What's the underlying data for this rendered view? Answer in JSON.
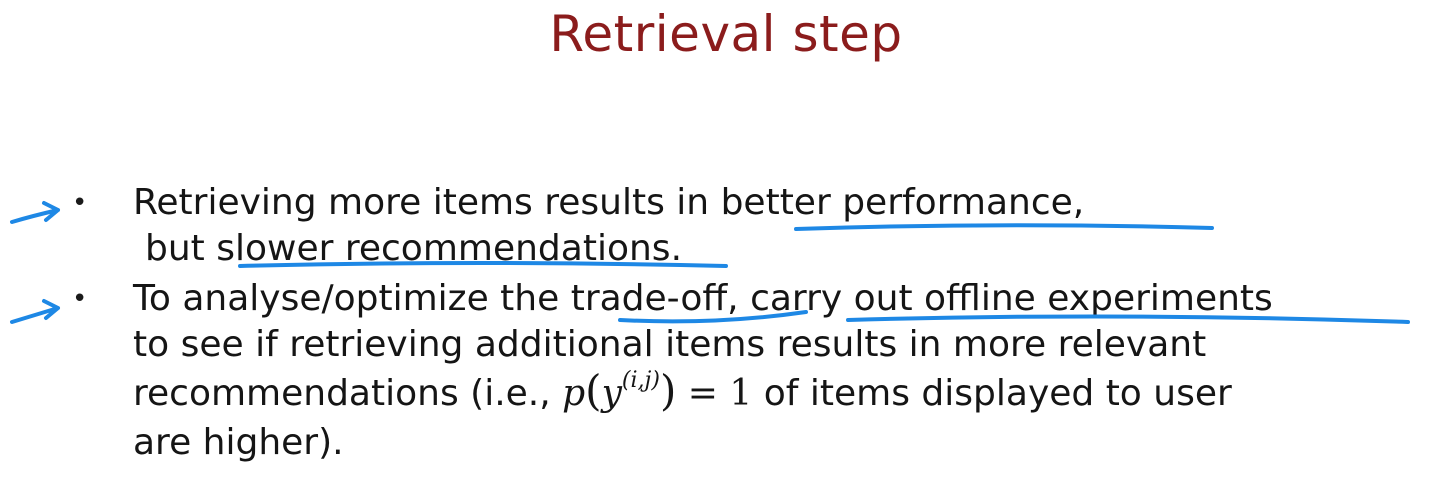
{
  "title": "Retrieval step",
  "bullets": [
    {
      "lines": [
        {
          "pre": "Retrieving more items results in ",
          "hl": "better performance",
          "post": ","
        },
        {
          "pre": "but s",
          "hl": "lower recommendations",
          "post": "."
        }
      ]
    },
    {
      "lines": [
        {
          "pre": "To analyse/optimize the ",
          "hl": "trade-off",
          "mid": ", ",
          "hl2": "carry out offline experiments"
        },
        {
          "text": "to see if retrieving additional items results in more relevant"
        },
        {
          "pre": "recommendations (i.e., ",
          "post": " of items displayed to user"
        },
        {
          "text": "are higher)."
        }
      ]
    }
  ],
  "math": {
    "p": "p",
    "y": "y",
    "sup": "(i,j)",
    "eq": "= 1"
  },
  "ink_color": "#1e88e5"
}
